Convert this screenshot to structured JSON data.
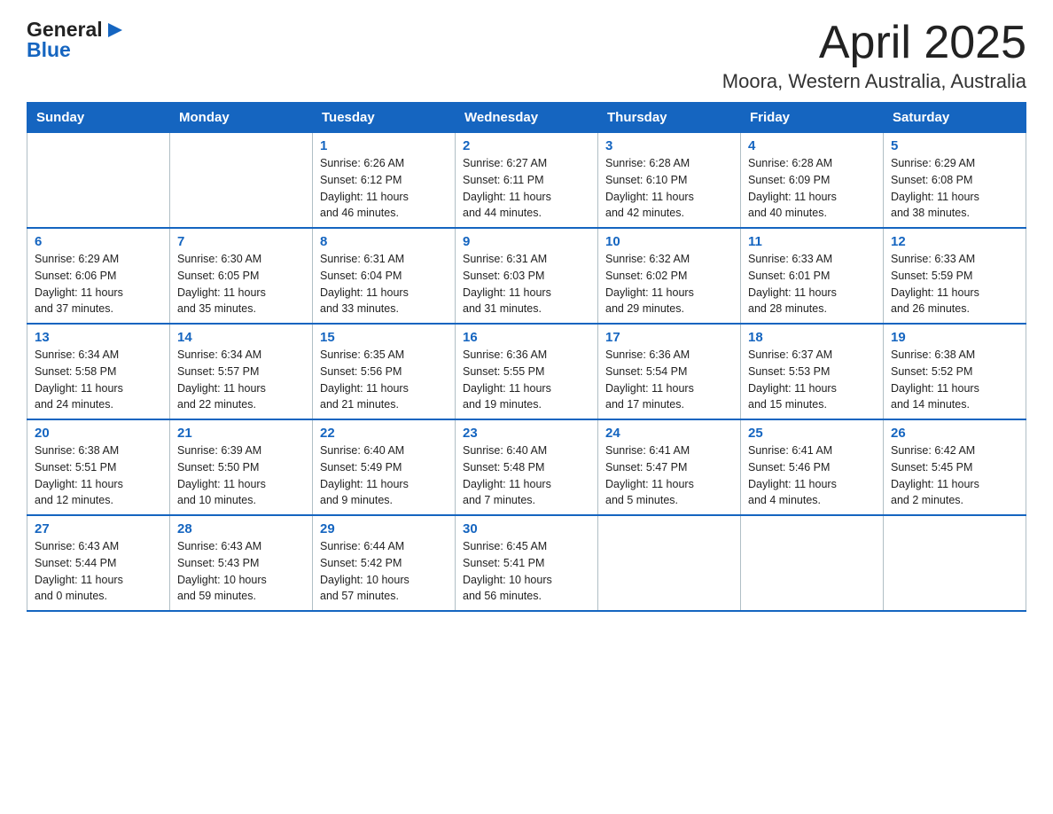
{
  "header": {
    "logo_text_general": "General",
    "logo_text_blue": "Blue",
    "month_title": "April 2025",
    "location": "Moora, Western Australia, Australia"
  },
  "days_of_week": [
    "Sunday",
    "Monday",
    "Tuesday",
    "Wednesday",
    "Thursday",
    "Friday",
    "Saturday"
  ],
  "weeks": [
    [
      {
        "day": "",
        "info": ""
      },
      {
        "day": "",
        "info": ""
      },
      {
        "day": "1",
        "info": "Sunrise: 6:26 AM\nSunset: 6:12 PM\nDaylight: 11 hours\nand 46 minutes."
      },
      {
        "day": "2",
        "info": "Sunrise: 6:27 AM\nSunset: 6:11 PM\nDaylight: 11 hours\nand 44 minutes."
      },
      {
        "day": "3",
        "info": "Sunrise: 6:28 AM\nSunset: 6:10 PM\nDaylight: 11 hours\nand 42 minutes."
      },
      {
        "day": "4",
        "info": "Sunrise: 6:28 AM\nSunset: 6:09 PM\nDaylight: 11 hours\nand 40 minutes."
      },
      {
        "day": "5",
        "info": "Sunrise: 6:29 AM\nSunset: 6:08 PM\nDaylight: 11 hours\nand 38 minutes."
      }
    ],
    [
      {
        "day": "6",
        "info": "Sunrise: 6:29 AM\nSunset: 6:06 PM\nDaylight: 11 hours\nand 37 minutes."
      },
      {
        "day": "7",
        "info": "Sunrise: 6:30 AM\nSunset: 6:05 PM\nDaylight: 11 hours\nand 35 minutes."
      },
      {
        "day": "8",
        "info": "Sunrise: 6:31 AM\nSunset: 6:04 PM\nDaylight: 11 hours\nand 33 minutes."
      },
      {
        "day": "9",
        "info": "Sunrise: 6:31 AM\nSunset: 6:03 PM\nDaylight: 11 hours\nand 31 minutes."
      },
      {
        "day": "10",
        "info": "Sunrise: 6:32 AM\nSunset: 6:02 PM\nDaylight: 11 hours\nand 29 minutes."
      },
      {
        "day": "11",
        "info": "Sunrise: 6:33 AM\nSunset: 6:01 PM\nDaylight: 11 hours\nand 28 minutes."
      },
      {
        "day": "12",
        "info": "Sunrise: 6:33 AM\nSunset: 5:59 PM\nDaylight: 11 hours\nand 26 minutes."
      }
    ],
    [
      {
        "day": "13",
        "info": "Sunrise: 6:34 AM\nSunset: 5:58 PM\nDaylight: 11 hours\nand 24 minutes."
      },
      {
        "day": "14",
        "info": "Sunrise: 6:34 AM\nSunset: 5:57 PM\nDaylight: 11 hours\nand 22 minutes."
      },
      {
        "day": "15",
        "info": "Sunrise: 6:35 AM\nSunset: 5:56 PM\nDaylight: 11 hours\nand 21 minutes."
      },
      {
        "day": "16",
        "info": "Sunrise: 6:36 AM\nSunset: 5:55 PM\nDaylight: 11 hours\nand 19 minutes."
      },
      {
        "day": "17",
        "info": "Sunrise: 6:36 AM\nSunset: 5:54 PM\nDaylight: 11 hours\nand 17 minutes."
      },
      {
        "day": "18",
        "info": "Sunrise: 6:37 AM\nSunset: 5:53 PM\nDaylight: 11 hours\nand 15 minutes."
      },
      {
        "day": "19",
        "info": "Sunrise: 6:38 AM\nSunset: 5:52 PM\nDaylight: 11 hours\nand 14 minutes."
      }
    ],
    [
      {
        "day": "20",
        "info": "Sunrise: 6:38 AM\nSunset: 5:51 PM\nDaylight: 11 hours\nand 12 minutes."
      },
      {
        "day": "21",
        "info": "Sunrise: 6:39 AM\nSunset: 5:50 PM\nDaylight: 11 hours\nand 10 minutes."
      },
      {
        "day": "22",
        "info": "Sunrise: 6:40 AM\nSunset: 5:49 PM\nDaylight: 11 hours\nand 9 minutes."
      },
      {
        "day": "23",
        "info": "Sunrise: 6:40 AM\nSunset: 5:48 PM\nDaylight: 11 hours\nand 7 minutes."
      },
      {
        "day": "24",
        "info": "Sunrise: 6:41 AM\nSunset: 5:47 PM\nDaylight: 11 hours\nand 5 minutes."
      },
      {
        "day": "25",
        "info": "Sunrise: 6:41 AM\nSunset: 5:46 PM\nDaylight: 11 hours\nand 4 minutes."
      },
      {
        "day": "26",
        "info": "Sunrise: 6:42 AM\nSunset: 5:45 PM\nDaylight: 11 hours\nand 2 minutes."
      }
    ],
    [
      {
        "day": "27",
        "info": "Sunrise: 6:43 AM\nSunset: 5:44 PM\nDaylight: 11 hours\nand 0 minutes."
      },
      {
        "day": "28",
        "info": "Sunrise: 6:43 AM\nSunset: 5:43 PM\nDaylight: 10 hours\nand 59 minutes."
      },
      {
        "day": "29",
        "info": "Sunrise: 6:44 AM\nSunset: 5:42 PM\nDaylight: 10 hours\nand 57 minutes."
      },
      {
        "day": "30",
        "info": "Sunrise: 6:45 AM\nSunset: 5:41 PM\nDaylight: 10 hours\nand 56 minutes."
      },
      {
        "day": "",
        "info": ""
      },
      {
        "day": "",
        "info": ""
      },
      {
        "day": "",
        "info": ""
      }
    ]
  ]
}
